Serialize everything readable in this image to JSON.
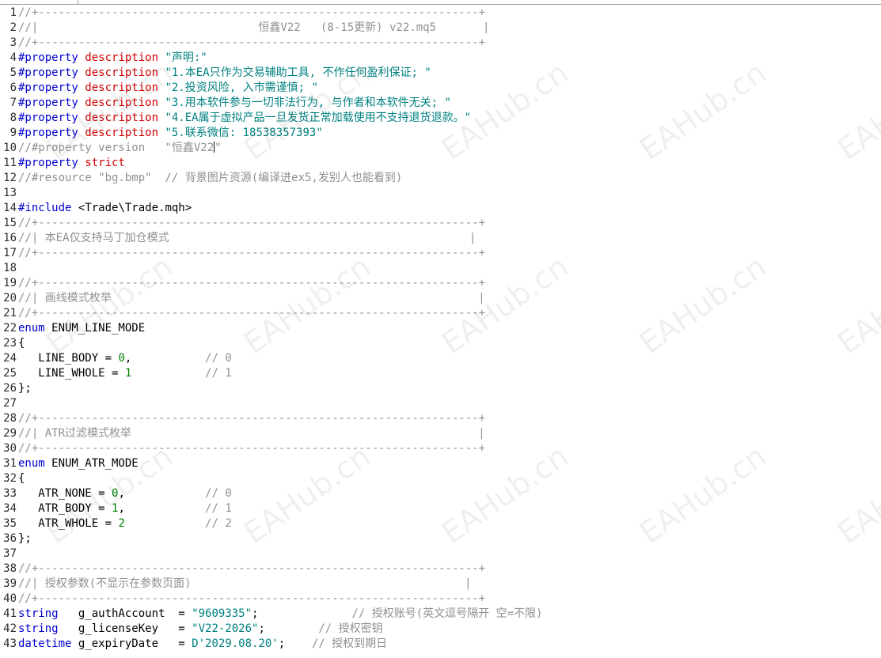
{
  "watermark": "EAHub.cn",
  "lines": [
    {
      "n": "1",
      "t": [
        [
          "cmt",
          "//+------------------------------------------------------------------+"
        ]
      ]
    },
    {
      "n": "2",
      "t": [
        [
          "cmt",
          "//|                                 恒鑫V22   (8-15更新) v22.mq5       |"
        ]
      ]
    },
    {
      "n": "3",
      "t": [
        [
          "cmt",
          "//+------------------------------------------------------------------+"
        ]
      ]
    },
    {
      "n": "4",
      "t": [
        [
          "dir",
          "#property"
        ],
        [
          "txt",
          " "
        ],
        [
          "red",
          "description"
        ],
        [
          "txt",
          " "
        ],
        [
          "str",
          "\"声明:\""
        ]
      ]
    },
    {
      "n": "5",
      "t": [
        [
          "dir",
          "#property"
        ],
        [
          "txt",
          " "
        ],
        [
          "red",
          "description"
        ],
        [
          "txt",
          " "
        ],
        [
          "str",
          "\"1.本EA只作为交易辅助工具, 不作任何盈利保证; \""
        ]
      ]
    },
    {
      "n": "6",
      "t": [
        [
          "dir",
          "#property"
        ],
        [
          "txt",
          " "
        ],
        [
          "red",
          "description"
        ],
        [
          "txt",
          " "
        ],
        [
          "str",
          "\"2.投资风险, 入市需谨慎; \""
        ]
      ]
    },
    {
      "n": "7",
      "t": [
        [
          "dir",
          "#property"
        ],
        [
          "txt",
          " "
        ],
        [
          "red",
          "description"
        ],
        [
          "txt",
          " "
        ],
        [
          "str",
          "\"3.用本软件参与一切非法行为, 与作者和本软件无关; \""
        ]
      ]
    },
    {
      "n": "8",
      "t": [
        [
          "dir",
          "#property"
        ],
        [
          "txt",
          " "
        ],
        [
          "red",
          "description"
        ],
        [
          "txt",
          " "
        ],
        [
          "str",
          "\"4.EA属于虚拟产品一旦发货正常加载使用不支持退货退款。\""
        ]
      ]
    },
    {
      "n": "9",
      "t": [
        [
          "dir",
          "#property"
        ],
        [
          "txt",
          " "
        ],
        [
          "red",
          "description"
        ],
        [
          "txt",
          " "
        ],
        [
          "str",
          "\"5.联系微信: 18538357393\""
        ]
      ]
    },
    {
      "n": "10",
      "t": [
        [
          "cmt",
          "//#property version   \"恒鑫V22"
        ],
        [
          "caret",
          ""
        ],
        [
          "cmt",
          "\""
        ]
      ]
    },
    {
      "n": "11",
      "t": [
        [
          "dir",
          "#property"
        ],
        [
          "txt",
          " "
        ],
        [
          "red",
          "strict"
        ]
      ]
    },
    {
      "n": "12",
      "t": [
        [
          "cmt",
          "//#resource \"bg.bmp\"  // 背景图片资源(编译进ex5,发别人也能看到)"
        ]
      ]
    },
    {
      "n": "13",
      "t": []
    },
    {
      "n": "14",
      "t": [
        [
          "dir",
          "#include"
        ],
        [
          "txt",
          " <Trade\\Trade.mqh>"
        ]
      ]
    },
    {
      "n": "15",
      "t": [
        [
          "cmt",
          "//+------------------------------------------------------------------+"
        ]
      ]
    },
    {
      "n": "16",
      "t": [
        [
          "cmt",
          "//| 本EA仅支持马丁加仓模式                                             |"
        ]
      ]
    },
    {
      "n": "17",
      "t": [
        [
          "cmt",
          "//+------------------------------------------------------------------+"
        ]
      ]
    },
    {
      "n": "18",
      "t": []
    },
    {
      "n": "19",
      "t": [
        [
          "cmt",
          "//+------------------------------------------------------------------+"
        ]
      ]
    },
    {
      "n": "20",
      "t": [
        [
          "cmt",
          "//| 画线模式枚举                                                       |"
        ]
      ]
    },
    {
      "n": "21",
      "t": [
        [
          "cmt",
          "//+------------------------------------------------------------------+"
        ]
      ]
    },
    {
      "n": "22",
      "t": [
        [
          "kw",
          "enum"
        ],
        [
          "txt",
          " ENUM_LINE_MODE"
        ]
      ]
    },
    {
      "n": "23",
      "t": [
        [
          "txt",
          "{"
        ]
      ]
    },
    {
      "n": "24",
      "t": [
        [
          "txt",
          "   LINE_BODY = "
        ],
        [
          "num",
          "0"
        ],
        [
          "txt",
          ",           "
        ],
        [
          "cmt",
          "// 0"
        ]
      ]
    },
    {
      "n": "25",
      "t": [
        [
          "txt",
          "   LINE_WHOLE = "
        ],
        [
          "num",
          "1"
        ],
        [
          "txt",
          "           "
        ],
        [
          "cmt",
          "// 1"
        ]
      ]
    },
    {
      "n": "26",
      "t": [
        [
          "txt",
          "};"
        ]
      ]
    },
    {
      "n": "27",
      "t": []
    },
    {
      "n": "28",
      "t": [
        [
          "cmt",
          "//+------------------------------------------------------------------+"
        ]
      ]
    },
    {
      "n": "29",
      "t": [
        [
          "cmt",
          "//| ATR过滤模式枚举                                                    |"
        ]
      ]
    },
    {
      "n": "30",
      "t": [
        [
          "cmt",
          "//+------------------------------------------------------------------+"
        ]
      ]
    },
    {
      "n": "31",
      "t": [
        [
          "kw",
          "enum"
        ],
        [
          "txt",
          " ENUM_ATR_MODE"
        ]
      ]
    },
    {
      "n": "32",
      "t": [
        [
          "txt",
          "{"
        ]
      ]
    },
    {
      "n": "33",
      "t": [
        [
          "txt",
          "   ATR_NONE = "
        ],
        [
          "num",
          "0"
        ],
        [
          "txt",
          ",            "
        ],
        [
          "cmt",
          "// 0"
        ]
      ]
    },
    {
      "n": "34",
      "t": [
        [
          "txt",
          "   ATR_BODY = "
        ],
        [
          "num",
          "1"
        ],
        [
          "txt",
          ",            "
        ],
        [
          "cmt",
          "// 1"
        ]
      ]
    },
    {
      "n": "35",
      "t": [
        [
          "txt",
          "   ATR_WHOLE = "
        ],
        [
          "num",
          "2"
        ],
        [
          "txt",
          "            "
        ],
        [
          "cmt",
          "// 2"
        ]
      ]
    },
    {
      "n": "36",
      "t": [
        [
          "txt",
          "};"
        ]
      ]
    },
    {
      "n": "37",
      "t": []
    },
    {
      "n": "38",
      "t": [
        [
          "cmt",
          "//+------------------------------------------------------------------+"
        ]
      ]
    },
    {
      "n": "39",
      "t": [
        [
          "cmt",
          "//| 授权参数(不显示在参数页面)                                         |"
        ]
      ]
    },
    {
      "n": "40",
      "t": [
        [
          "cmt",
          "//+------------------------------------------------------------------+"
        ]
      ]
    },
    {
      "n": "41",
      "t": [
        [
          "kw",
          "string"
        ],
        [
          "txt",
          "   g_authAccount  = "
        ],
        [
          "str",
          "\"9609335\""
        ],
        [
          "txt",
          ";              "
        ],
        [
          "cmt",
          "// 授权账号(英文逗号隔开 空=不限)"
        ]
      ]
    },
    {
      "n": "42",
      "t": [
        [
          "kw",
          "string"
        ],
        [
          "txt",
          "   g_licenseKey   = "
        ],
        [
          "str",
          "\"V22-2026\""
        ],
        [
          "txt",
          ";        "
        ],
        [
          "cmt",
          "// 授权密钥"
        ]
      ]
    },
    {
      "n": "43",
      "t": [
        [
          "kw",
          "datetime"
        ],
        [
          "txt",
          " g_expiryDate   = "
        ],
        [
          "str",
          "D'2029.08.20'"
        ],
        [
          "txt",
          ";    "
        ],
        [
          "cmt",
          "// 授权到期日"
        ]
      ]
    }
  ]
}
